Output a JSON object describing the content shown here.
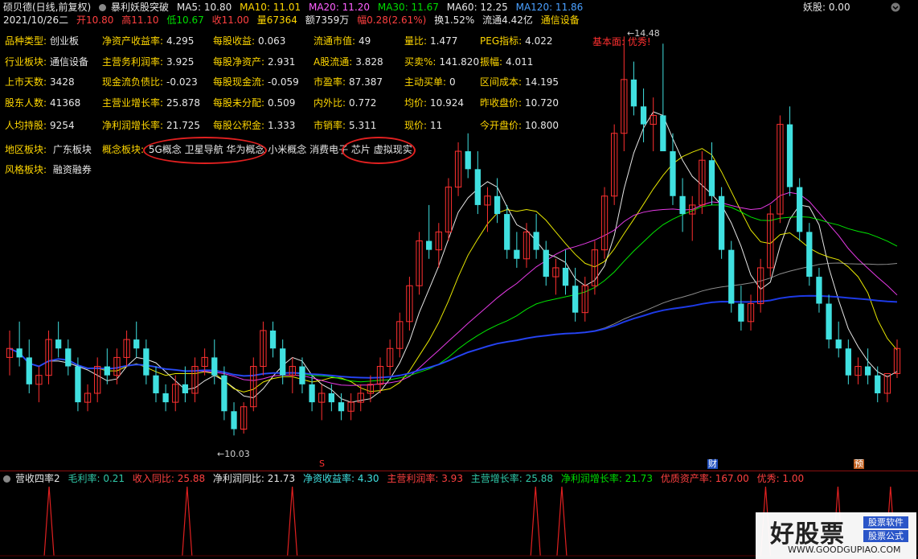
{
  "header": {
    "row1": {
      "title": "硕贝德(日线,前复权)",
      "indicator_name": "暴利妖股突破",
      "ma5": "MA5: 10.80",
      "ma10": "MA10: 11.01",
      "ma20": "MA20: 11.20",
      "ma30": "MA30: 11.67",
      "ma60": "MA60: 12.25",
      "ma120": "MA120: 11.86",
      "right_label": "妖股: 0.00"
    },
    "row2": {
      "date": "2021/10/26二",
      "open": "开10.80",
      "high": "高11.10",
      "low": "低10.67",
      "close": "收11.00",
      "volume": "量67364",
      "amount": "额7359万",
      "change": "幅0.28(2.61%)",
      "turnover": "换1.52%",
      "float": "流通4.42亿",
      "industry": "通信设备"
    }
  },
  "fundamentals": [
    {
      "label": "品种类型:",
      "value": "创业板"
    },
    {
      "label": "净资产收益率:",
      "value": "4.295"
    },
    {
      "label": "每股收益:",
      "value": "0.063"
    },
    {
      "label": "流通市值:",
      "value": "49"
    },
    {
      "label": "量比:",
      "value": "1.477"
    },
    {
      "label": "PEG指标:",
      "value": "4.022"
    },
    {
      "label": "行业板块:",
      "value": "通信设备"
    },
    {
      "label": "主营务利润率:",
      "value": "3.925"
    },
    {
      "label": "每股净资产:",
      "value": "2.931"
    },
    {
      "label": "A股流通:",
      "value": "3.828"
    },
    {
      "label": "买卖%:",
      "value": "141.820"
    },
    {
      "label": "振幅:",
      "value": "4.011"
    },
    {
      "label": "上市天数:",
      "value": "3428"
    },
    {
      "label": "现金流负债比:",
      "value": "-0.023"
    },
    {
      "label": "每股现金流:",
      "value": "-0.059"
    },
    {
      "label": "市盈率:",
      "value": "87.387"
    },
    {
      "label": "主动买单:",
      "value": "0"
    },
    {
      "label": "区间成本:",
      "value": "14.195"
    },
    {
      "label": "股东人数:",
      "value": "41368"
    },
    {
      "label": "主营业增长率:",
      "value": "25.878"
    },
    {
      "label": "每股未分配:",
      "value": "0.509"
    },
    {
      "label": "内外比:",
      "value": "0.772"
    },
    {
      "label": "均价:",
      "value": "10.924"
    },
    {
      "label": "昨收盘价:",
      "value": "10.720"
    },
    {
      "label": "人均持股:",
      "value": "9254"
    },
    {
      "label": "净利润增长率:",
      "value": "21.725"
    },
    {
      "label": "每股公积金:",
      "value": "1.333"
    },
    {
      "label": "市销率:",
      "value": "5.311"
    },
    {
      "label": "现价:",
      "value": "11"
    },
    {
      "label": "今开盘价:",
      "value": "10.800"
    }
  ],
  "sectors": {
    "region_label": "地区板块:",
    "region_value": "广东板块",
    "concept_label": "概念板块:",
    "concept_value": "5G概念 卫星导航 华为概念 小米概念 消费电子 芯片 虚拟现实",
    "style_label": "风格板块:",
    "style_value": "融资融券"
  },
  "annotation": "基本面: 优秀!",
  "price_labels": {
    "high": "14.48",
    "low": "10.03"
  },
  "markers": {
    "s": "S",
    "cai": "财",
    "yu": "预"
  },
  "indicator_bar": {
    "name": "营收四率2",
    "gross_margin": "毛利率: 0.21",
    "revenue_yoy": "收入同比: 25.88",
    "profit_yoy": "净利润同比: 21.73",
    "roe": "净资收益率: 4.30",
    "main_profit_rate": "主营利润率: 3.93",
    "main_growth": "主营增长率: 25.88",
    "net_profit_growth": "净利润增长率: 21.73",
    "quality_asset": "优质资产率: 167.00",
    "excellent": "优秀: 1.00"
  },
  "watermark": {
    "main": "好股票",
    "tag1": "股票软件",
    "tag2": "股票公式",
    "url": "WWW.GOODGUPIAO.COM"
  },
  "colors": {
    "up": "#ff3030",
    "down": "#40e0e0",
    "ma5": "#ffffff",
    "ma10": "#ffff00",
    "ma20": "#ff40ff",
    "ma30": "#00ff00",
    "ma60": "#c8c8c8",
    "ma120": "#2040ff"
  },
  "chart_data": {
    "type": "candlestick",
    "ylim": [
      9.8,
      14.6
    ],
    "candles": [
      [
        10.9,
        11.2,
        10.7,
        11.0
      ],
      [
        11.0,
        11.3,
        10.8,
        10.9
      ],
      [
        10.9,
        11.1,
        10.5,
        10.6
      ],
      [
        10.6,
        10.8,
        10.4,
        10.7
      ],
      [
        10.7,
        11.2,
        10.6,
        11.1
      ],
      [
        11.1,
        11.3,
        10.9,
        11.0
      ],
      [
        11.0,
        11.1,
        10.7,
        10.8
      ],
      [
        10.8,
        10.9,
        10.3,
        10.4
      ],
      [
        10.4,
        10.6,
        10.3,
        10.5
      ],
      [
        10.5,
        10.9,
        10.4,
        10.8
      ],
      [
        10.8,
        11.0,
        10.6,
        10.7
      ],
      [
        10.7,
        11.0,
        10.6,
        10.9
      ],
      [
        10.9,
        11.2,
        10.8,
        11.1
      ],
      [
        11.1,
        11.3,
        10.9,
        11.0
      ],
      [
        11.0,
        11.1,
        10.6,
        10.7
      ],
      [
        10.7,
        10.8,
        10.4,
        10.5
      ],
      [
        10.5,
        10.6,
        10.3,
        10.4
      ],
      [
        10.4,
        10.7,
        10.3,
        10.6
      ],
      [
        10.6,
        10.8,
        10.4,
        10.5
      ],
      [
        10.5,
        10.9,
        10.4,
        10.8
      ],
      [
        10.8,
        11.0,
        10.7,
        10.9
      ],
      [
        10.9,
        11.1,
        10.6,
        10.7
      ],
      [
        10.7,
        10.8,
        10.2,
        10.3
      ],
      [
        10.3,
        10.4,
        10.03,
        10.1
      ],
      [
        10.1,
        10.4,
        10.05,
        10.35
      ],
      [
        10.35,
        10.9,
        10.3,
        10.8
      ],
      [
        10.8,
        11.3,
        10.7,
        11.2
      ],
      [
        11.2,
        11.3,
        10.9,
        11.0
      ],
      [
        11.0,
        11.1,
        10.6,
        10.7
      ],
      [
        10.7,
        10.9,
        10.5,
        10.8
      ],
      [
        10.8,
        10.9,
        10.5,
        10.6
      ],
      [
        10.6,
        10.7,
        10.3,
        10.4
      ],
      [
        10.4,
        10.6,
        10.2,
        10.5
      ],
      [
        10.5,
        10.6,
        10.3,
        10.4
      ],
      [
        10.4,
        10.5,
        10.2,
        10.3
      ],
      [
        10.3,
        10.5,
        10.2,
        10.4
      ],
      [
        10.4,
        10.6,
        10.3,
        10.5
      ],
      [
        10.5,
        10.7,
        10.4,
        10.6
      ],
      [
        10.6,
        10.9,
        10.5,
        10.8
      ],
      [
        10.8,
        11.1,
        10.7,
        11.0
      ],
      [
        11.0,
        11.4,
        10.9,
        11.3
      ],
      [
        11.3,
        11.8,
        11.2,
        11.7
      ],
      [
        11.7,
        12.3,
        11.6,
        12.2
      ],
      [
        12.2,
        12.6,
        12.0,
        12.1
      ],
      [
        12.1,
        12.4,
        11.9,
        12.3
      ],
      [
        12.3,
        12.9,
        12.2,
        12.8
      ],
      [
        12.8,
        13.3,
        12.7,
        13.2
      ],
      [
        13.2,
        13.4,
        12.9,
        13.0
      ],
      [
        13.0,
        13.2,
        12.5,
        12.6
      ],
      [
        12.6,
        12.8,
        12.3,
        12.7
      ],
      [
        12.7,
        12.9,
        12.4,
        12.5
      ],
      [
        12.5,
        12.6,
        12.0,
        12.1
      ],
      [
        12.1,
        12.3,
        11.9,
        12.0
      ],
      [
        12.0,
        12.4,
        11.9,
        12.3
      ],
      [
        12.3,
        12.5,
        12.0,
        12.1
      ],
      [
        12.1,
        12.2,
        11.7,
        11.8
      ],
      [
        11.8,
        12.0,
        11.6,
        11.9
      ],
      [
        11.9,
        12.1,
        11.6,
        11.7
      ],
      [
        11.7,
        11.9,
        11.3,
        11.4
      ],
      [
        11.4,
        11.8,
        11.3,
        11.7
      ],
      [
        11.7,
        12.2,
        11.6,
        12.1
      ],
      [
        12.1,
        12.8,
        12.0,
        12.7
      ],
      [
        12.7,
        13.5,
        12.6,
        13.4
      ],
      [
        13.4,
        14.48,
        13.2,
        14.0
      ],
      [
        14.0,
        14.2,
        13.6,
        13.7
      ],
      [
        13.7,
        13.9,
        13.3,
        13.5
      ],
      [
        13.5,
        13.8,
        13.2,
        13.6
      ],
      [
        13.6,
        14.4,
        13.5,
        13.2
      ],
      [
        13.2,
        13.4,
        12.6,
        12.7
      ],
      [
        12.7,
        12.9,
        12.3,
        12.5
      ],
      [
        12.5,
        12.7,
        12.2,
        12.6
      ],
      [
        12.6,
        13.2,
        12.5,
        13.1
      ],
      [
        13.1,
        13.3,
        12.6,
        12.7
      ],
      [
        12.7,
        12.8,
        12.0,
        12.1
      ],
      [
        12.1,
        12.2,
        11.4,
        11.5
      ],
      [
        11.5,
        11.7,
        11.2,
        11.3
      ],
      [
        11.3,
        11.6,
        11.2,
        11.5
      ],
      [
        11.5,
        12.0,
        11.4,
        11.9
      ],
      [
        11.9,
        12.6,
        11.8,
        12.5
      ],
      [
        12.5,
        13.6,
        12.4,
        13.5
      ],
      [
        13.5,
        13.7,
        12.7,
        12.8
      ],
      [
        12.8,
        12.9,
        12.2,
        12.3
      ],
      [
        12.3,
        12.4,
        11.7,
        11.8
      ],
      [
        11.8,
        11.9,
        11.4,
        11.5
      ],
      [
        11.5,
        11.6,
        11.0,
        11.1
      ],
      [
        11.1,
        11.3,
        10.9,
        11.0
      ],
      [
        11.0,
        11.1,
        10.6,
        10.7
      ],
      [
        10.7,
        10.9,
        10.6,
        10.8
      ],
      [
        10.8,
        11.0,
        10.6,
        10.7
      ],
      [
        10.7,
        10.8,
        10.4,
        10.5
      ],
      [
        10.5,
        10.7,
        10.4,
        10.72
      ],
      [
        10.72,
        11.1,
        10.67,
        11.0
      ]
    ],
    "volume_note": ""
  },
  "indicator_data": {
    "spikes": [
      6,
      27,
      43,
      80,
      84,
      115,
      126,
      134
    ],
    "count": 136
  }
}
